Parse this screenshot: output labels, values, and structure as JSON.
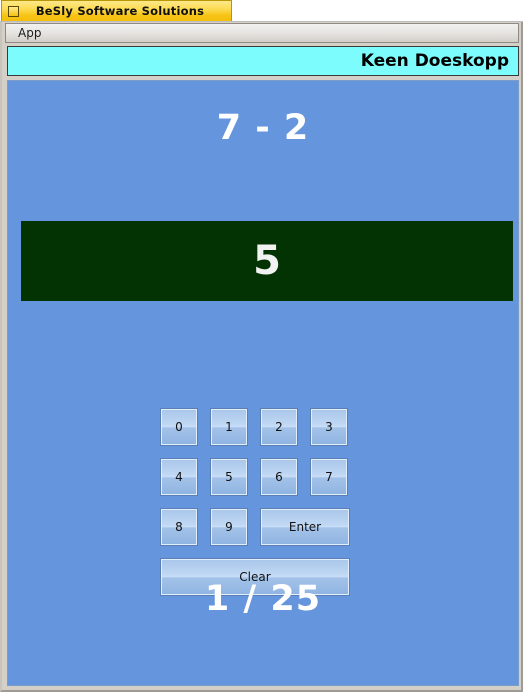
{
  "window": {
    "title": "BeSly Software Solutions",
    "icon": "app-window-icon"
  },
  "menubar": {
    "items": [
      {
        "label": "App"
      }
    ]
  },
  "banner": {
    "title": "Keen Doeskopp"
  },
  "main": {
    "question": "7 - 2",
    "answer": "5",
    "counter": "1 / 25",
    "keypad": {
      "rows": [
        [
          {
            "label": "0",
            "type": "digit"
          },
          {
            "label": "1",
            "type": "digit"
          },
          {
            "label": "2",
            "type": "digit"
          },
          {
            "label": "3",
            "type": "digit"
          }
        ],
        [
          {
            "label": "4",
            "type": "digit"
          },
          {
            "label": "5",
            "type": "digit"
          },
          {
            "label": "6",
            "type": "digit"
          },
          {
            "label": "7",
            "type": "digit"
          }
        ],
        [
          {
            "label": "8",
            "type": "digit"
          },
          {
            "label": "9",
            "type": "digit"
          },
          {
            "label": "Enter",
            "type": "enter"
          }
        ],
        [
          {
            "label": "Clear",
            "type": "clear"
          }
        ]
      ]
    }
  },
  "colors": {
    "title_bar": "#f7c518",
    "banner_background": "#7dfcfd",
    "panel_background": "#6495dd",
    "answer_background": "#033303",
    "answer_text": "#f2f2f2",
    "key_face": "#bcd5f2"
  }
}
